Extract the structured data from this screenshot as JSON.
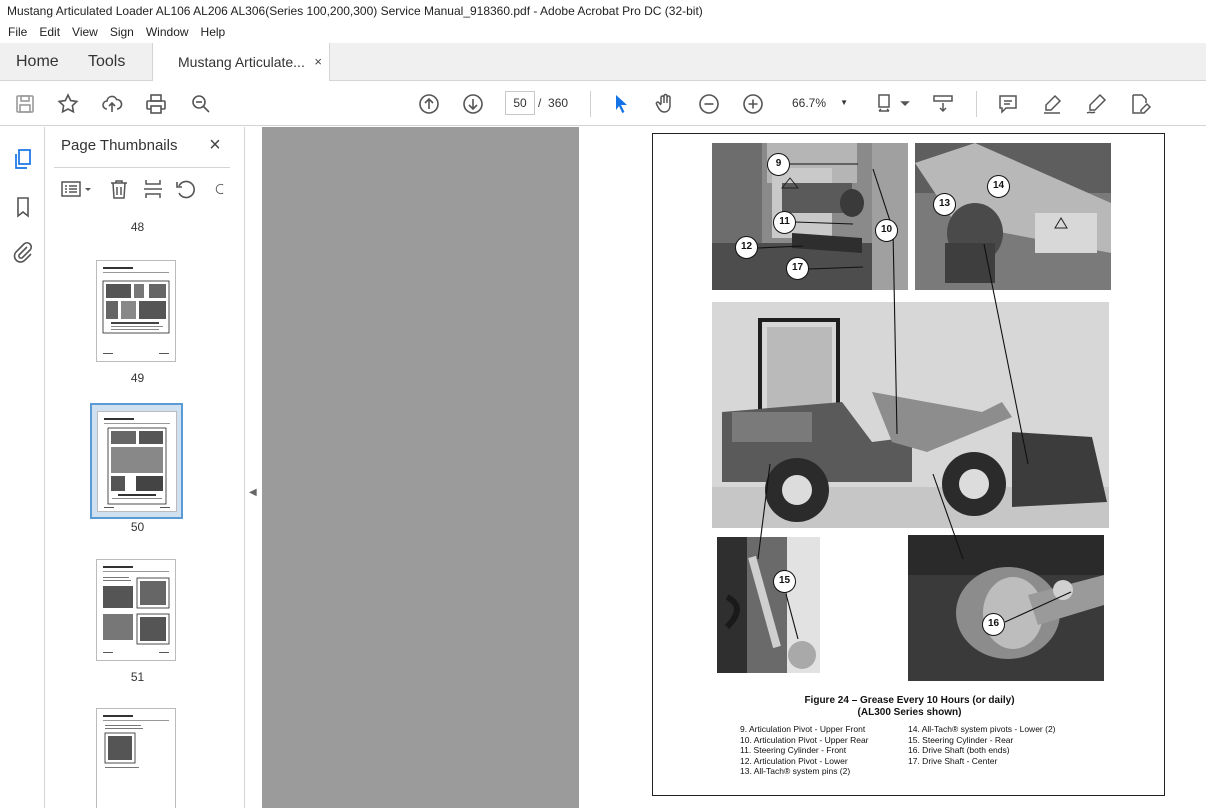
{
  "window": {
    "title": "Mustang Articulated Loader AL106 AL206 AL306(Series 100,200,300) Service Manual_918360.pdf - Adobe Acrobat Pro DC (32-bit)"
  },
  "menu": [
    "File",
    "Edit",
    "View",
    "Sign",
    "Window",
    "Help"
  ],
  "tabs": {
    "home": "Home",
    "tools": "Tools",
    "document": "Mustang Articulate...",
    "close": "×"
  },
  "toolbar": {
    "current_page": "50",
    "page_separator": "/",
    "total_pages": "360",
    "zoom": "66.7%"
  },
  "panel": {
    "title": "Page Thumbnails",
    "close": "×",
    "thumbnails": [
      {
        "label": "48",
        "selected": false
      },
      {
        "label": "49",
        "selected": false
      },
      {
        "label": "50",
        "selected": true
      },
      {
        "label": "51",
        "selected": false
      }
    ]
  },
  "page": {
    "callouts": [
      "9",
      "10",
      "11",
      "12",
      "17",
      "13",
      "14",
      "15",
      "16"
    ],
    "figure_title": "Figure 24 – Grease Every 10 Hours (or daily)",
    "figure_subtitle": "(AL300 Series shown)",
    "legend_left": [
      "9. Articulation Pivot - Upper Front",
      "10. Articulation Pivot - Upper Rear",
      "11. Steering Cylinder - Front",
      "12. Articulation Pivot - Lower",
      "13. All-Tach® system pins (2)"
    ],
    "legend_right": [
      "14. All-Tach® system pivots - Lower (2)",
      "15. Steering Cylinder - Rear",
      "16. Drive Shaft (both ends)",
      "17. Drive Shaft - Center"
    ]
  },
  "colors": {
    "accent_blue": "#1473e6",
    "doc_background": "#9b9b9b",
    "selection": "#cfe0f1"
  }
}
